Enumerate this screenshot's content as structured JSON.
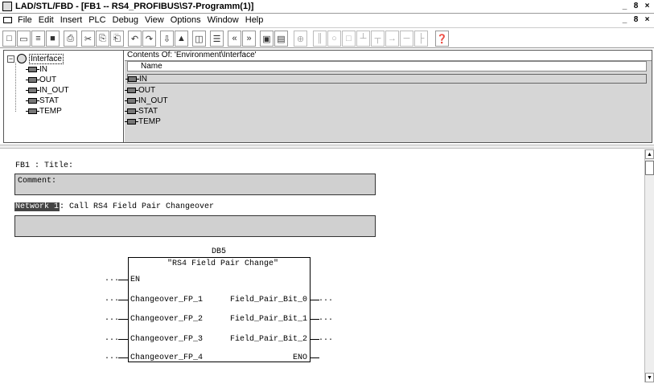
{
  "window": {
    "title": "LAD/STL/FBD - [FB1 -- RS4_PROFIBUS\\S7-Programm(1)]",
    "buttons": [
      "_",
      "8",
      "×"
    ]
  },
  "menu": {
    "items": [
      "File",
      "Edit",
      "Insert",
      "PLC",
      "Debug",
      "View",
      "Options",
      "Window",
      "Help"
    ],
    "doc_buttons": [
      "_",
      "8",
      "×"
    ]
  },
  "toolbar": {
    "buttons": [
      {
        "name": "new-icon",
        "glyph": "□"
      },
      {
        "name": "open-icon",
        "glyph": "▭"
      },
      {
        "name": "accessible-nodes-icon",
        "glyph": "≡"
      },
      {
        "name": "save-icon",
        "glyph": "■"
      },
      {
        "name": "print-icon",
        "glyph": "⎙"
      },
      {
        "name": "cut-icon",
        "glyph": "✂"
      },
      {
        "name": "copy-icon",
        "glyph": "⎘"
      },
      {
        "name": "paste-icon",
        "glyph": "⎗"
      },
      {
        "name": "undo-icon",
        "glyph": "↶"
      },
      {
        "name": "redo-icon",
        "glyph": "↷"
      },
      {
        "name": "download-icon",
        "glyph": "⇩"
      },
      {
        "name": "monitor-icon",
        "glyph": "▲"
      },
      {
        "name": "overview-icon",
        "glyph": "◫"
      },
      {
        "name": "details-icon",
        "glyph": "☰"
      },
      {
        "name": "prev-network-icon",
        "glyph": "«"
      },
      {
        "name": "next-network-icon",
        "glyph": "»"
      },
      {
        "name": "overview-panel-icon",
        "glyph": "▣"
      },
      {
        "name": "detail-panel-icon",
        "glyph": "▤"
      },
      {
        "name": "new-network-icon",
        "glyph": "⊕"
      },
      {
        "name": "contact-icon",
        "glyph": "║"
      },
      {
        "name": "coil-icon",
        "glyph": "○"
      },
      {
        "name": "box-icon",
        "glyph": "□"
      },
      {
        "name": "branch-open-icon",
        "glyph": "┴"
      },
      {
        "name": "branch-close-icon",
        "glyph": "┬"
      },
      {
        "name": "connection-icon",
        "glyph": "→"
      },
      {
        "name": "wire-icon",
        "glyph": "─"
      },
      {
        "name": "split-icon",
        "glyph": "├"
      },
      {
        "name": "help-icon",
        "glyph": "❓"
      }
    ]
  },
  "interface_tree": {
    "root": "Interface",
    "items": [
      "IN",
      "OUT",
      "IN_OUT",
      "STAT",
      "TEMP"
    ]
  },
  "contents": {
    "header": "Contents Of: 'Environment\\Interface'",
    "column": "Name",
    "rows": [
      "IN",
      "OUT",
      "IN_OUT",
      "STAT",
      "TEMP"
    ]
  },
  "editor": {
    "block_title": "FB1 : Title:",
    "comment_label": "Comment:",
    "network_tag": "Network 1",
    "network_title": ": Call RS4 Field Pair Changeover",
    "instance_db": "DB5",
    "block_name": "\"RS4 Field Pair Change\"",
    "inputs": [
      "EN",
      "Changeover_FP_1",
      "Changeover_FP_2",
      "Changeover_FP_3",
      "Changeover_FP_4"
    ],
    "outputs": [
      "Field_Pair_Bit_0",
      "Field_Pair_Bit_1",
      "Field_Pair_Bit_2",
      "ENO"
    ],
    "input_params": [
      "...",
      "...",
      "...",
      "...",
      "..."
    ],
    "output_params": [
      "...",
      "...",
      "..."
    ]
  }
}
